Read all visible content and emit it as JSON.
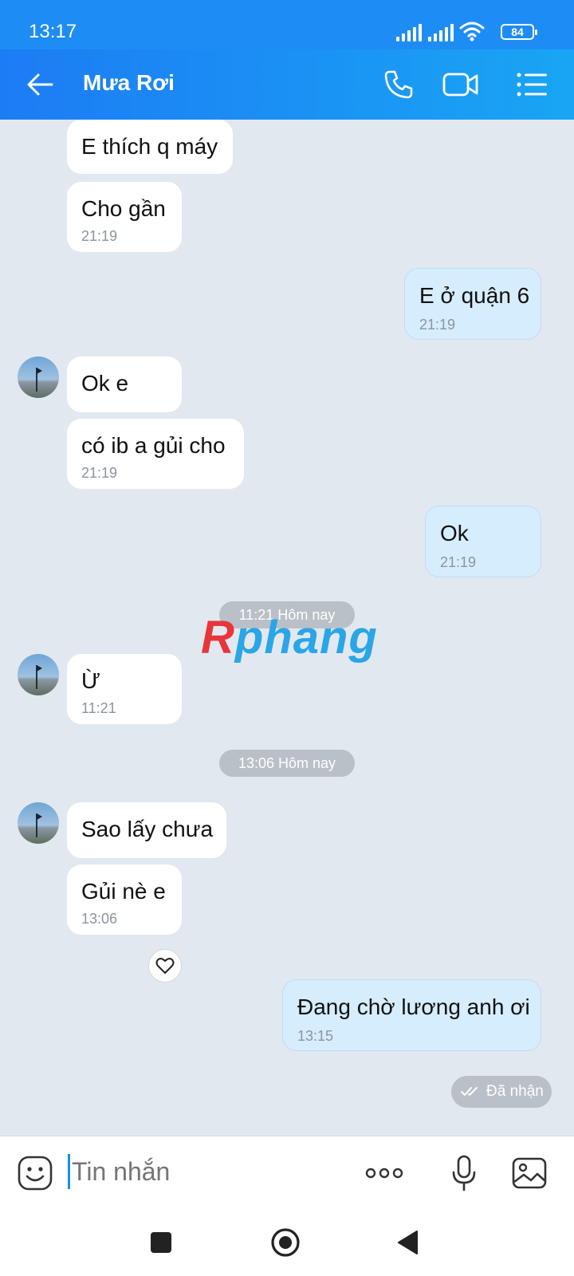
{
  "status_bar": {
    "time": "13:17",
    "battery": "84"
  },
  "header": {
    "title": "Mưa Rơi",
    "icons": [
      "back-arrow-icon",
      "phone-icon",
      "video-call-icon",
      "menu-list-icon"
    ]
  },
  "messages": [
    {
      "text": "E thích q máy",
      "time": ""
    },
    {
      "text": "Cho gần",
      "time": "21:19"
    },
    {
      "text": "E ở quận 6",
      "time": "21:19"
    },
    {
      "text": "Ok e",
      "time": ""
    },
    {
      "text": "có ib a gủi cho",
      "time": "21:19"
    },
    {
      "text": "Ok",
      "time": "21:19"
    },
    {
      "text": "Ừ",
      "time": "11:21"
    },
    {
      "text": "Sao lấy chưa",
      "time": ""
    },
    {
      "text": "Gủi nè e",
      "time": "13:06"
    },
    {
      "text": "Đang chờ lương anh ơi",
      "time": "13:15"
    }
  ],
  "separators": [
    "11:21 Hôm nay",
    "13:06 Hôm nay"
  ],
  "received_label": "Đã nhận",
  "watermark": {
    "first": "R",
    "rest": "phang"
  },
  "composer": {
    "placeholder": "Tin nhắn"
  },
  "colors": {
    "header_start": "#1c7cf4",
    "header_end": "#19a5f4",
    "outgoing_bubble": "#d6edfd",
    "incoming_bubble": "#ffffff",
    "chat_bg": "#e2e8ef"
  }
}
